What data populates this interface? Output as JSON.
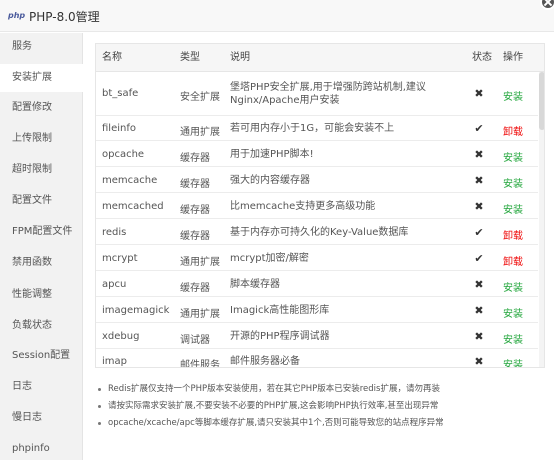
{
  "window": {
    "logo": "php",
    "title": "PHP-8.0管理"
  },
  "sidebar": {
    "items": [
      {
        "label": "服务",
        "active": false
      },
      {
        "label": "安装扩展",
        "active": true
      },
      {
        "label": "配置修改",
        "active": false
      },
      {
        "label": "上传限制",
        "active": false
      },
      {
        "label": "超时限制",
        "active": false
      },
      {
        "label": "配置文件",
        "active": false
      },
      {
        "label": "FPM配置文件",
        "active": false
      },
      {
        "label": "禁用函数",
        "active": false
      },
      {
        "label": "性能调整",
        "active": false
      },
      {
        "label": "负载状态",
        "active": false
      },
      {
        "label": "Session配置",
        "active": false
      },
      {
        "label": "日志",
        "active": false
      },
      {
        "label": "慢日志",
        "active": false
      },
      {
        "label": "phpinfo",
        "active": false
      }
    ]
  },
  "table": {
    "headers": {
      "name": "名称",
      "type": "类型",
      "desc": "说明",
      "status": "状态",
      "op": "操作"
    },
    "rows": [
      {
        "name": "bt_safe",
        "type": "安全扩展",
        "desc": "堡塔PHP安全扩展,用于增强防跨站机制,建议Nginx/Apache用户安装",
        "status": "✖",
        "op": "安装"
      },
      {
        "name": "fileinfo",
        "type": "通用扩展",
        "desc": "若可用内存小于1G，可能会安装不上",
        "status": "✔",
        "op": "卸载"
      },
      {
        "name": "opcache",
        "type": "缓存器",
        "desc": "用于加速PHP脚本!",
        "status": "✖",
        "op": "安装"
      },
      {
        "name": "memcache",
        "type": "缓存器",
        "desc": "强大的内容缓存器",
        "status": "✖",
        "op": "安装"
      },
      {
        "name": "memcached",
        "type": "缓存器",
        "desc": "比memcache支持更多高级功能",
        "status": "✖",
        "op": "安装"
      },
      {
        "name": "redis",
        "type": "缓存器",
        "desc": "基于内存亦可持久化的Key-Value数据库",
        "status": "✔",
        "op": "卸载"
      },
      {
        "name": "mcrypt",
        "type": "通用扩展",
        "desc": "mcrypt加密/解密",
        "status": "✔",
        "op": "卸载"
      },
      {
        "name": "apcu",
        "type": "缓存器",
        "desc": "脚本缓存器",
        "status": "✖",
        "op": "安装"
      },
      {
        "name": "imagemagick",
        "type": "通用扩展",
        "desc": "Imagick高性能图形库",
        "status": "✖",
        "op": "安装"
      },
      {
        "name": "xdebug",
        "type": "调试器",
        "desc": "开源的PHP程序调试器",
        "status": "✖",
        "op": "安装"
      },
      {
        "name": "imap",
        "type": "邮件服务",
        "desc": "邮件服务器必备",
        "status": "✖",
        "op": "安装"
      }
    ]
  },
  "notes": [
    "Redis扩展仅支持一个PHP版本安装使用，若在其它PHP版本已安装redis扩展，请勿再装",
    "请按实际需求安装扩展,不要安装不必要的PHP扩展,这会影响PHP执行效率,甚至出现异常",
    "opcache/xcache/apc等脚本缓存扩展,请只安装其中1个,否则可能导致您的站点程序异常"
  ],
  "colors": {
    "install": "#20a53a",
    "uninstall": "#ef0808",
    "sidebar_bg": "#f2f2f2"
  }
}
